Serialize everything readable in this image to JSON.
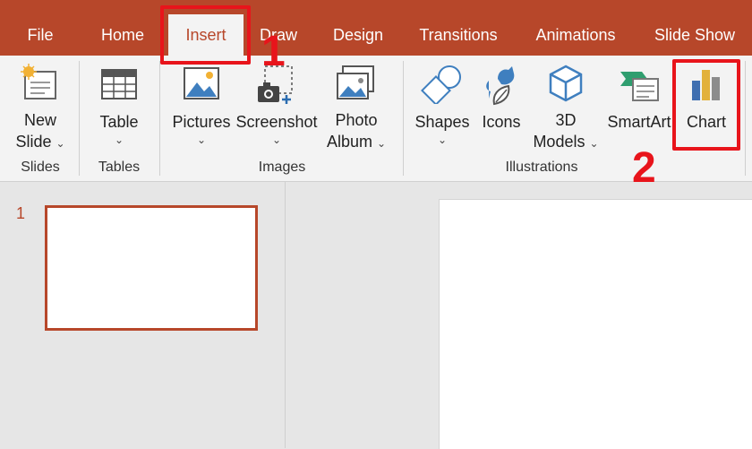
{
  "tabs": [
    {
      "id": "file",
      "label": "File"
    },
    {
      "id": "home",
      "label": "Home"
    },
    {
      "id": "insert",
      "label": "Insert",
      "active": true
    },
    {
      "id": "draw",
      "label": "Draw"
    },
    {
      "id": "design",
      "label": "Design"
    },
    {
      "id": "transitions",
      "label": "Transitions"
    },
    {
      "id": "animations",
      "label": "Animations"
    },
    {
      "id": "slideshow",
      "label": "Slide Show"
    }
  ],
  "ribbon": {
    "slides": {
      "group_label": "Slides",
      "new_slide": [
        "New",
        "Slide"
      ]
    },
    "tables": {
      "group_label": "Tables",
      "table": "Table"
    },
    "images": {
      "group_label": "Images",
      "pictures": "Pictures",
      "screenshot": "Screenshot",
      "photo_album": [
        "Photo",
        "Album"
      ]
    },
    "illustrations": {
      "group_label": "Illustrations",
      "shapes": "Shapes",
      "icons": "Icons",
      "models_3d": [
        "3D",
        "Models"
      ],
      "smartart": "SmartArt",
      "chart": "Chart"
    }
  },
  "slide_panel": {
    "slide_number": "1"
  },
  "annotations": {
    "step1": "1",
    "step2": "2"
  },
  "colors": {
    "accent": "#b7472a",
    "highlight": "#e8141b",
    "ribbon_bg": "#f3f3f3"
  }
}
